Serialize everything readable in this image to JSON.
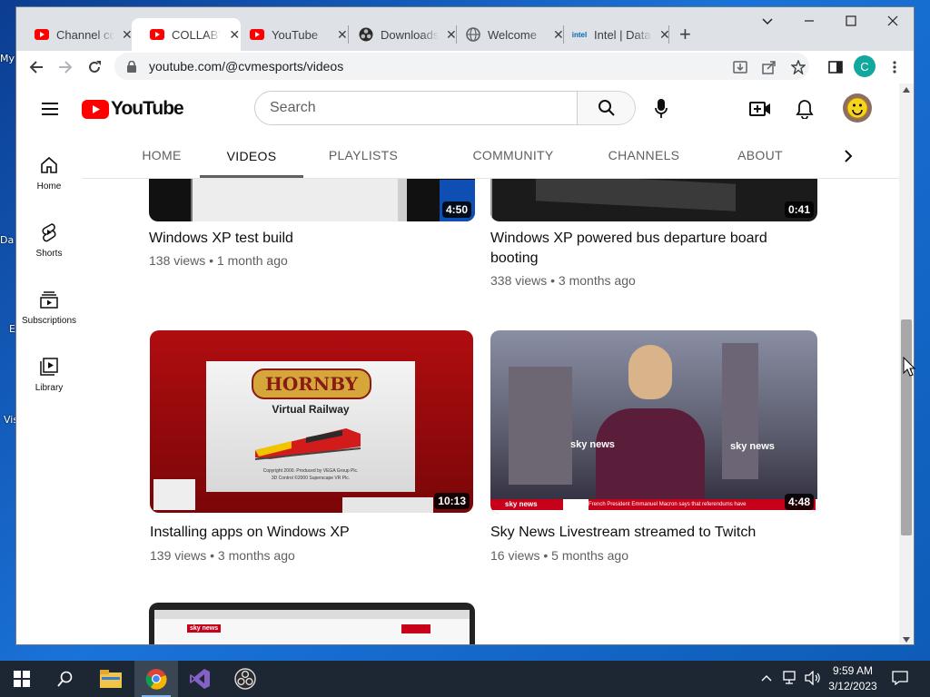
{
  "desktop": {
    "icon_labels": [
      "My",
      "Da",
      "E",
      "Vis"
    ]
  },
  "browser": {
    "tabs": [
      {
        "title": "Channel content",
        "favicon": "youtube-icon",
        "active": false
      },
      {
        "title": "COLLABVM",
        "favicon": "youtube-icon",
        "active": true
      },
      {
        "title": "YouTube",
        "favicon": "youtube-icon",
        "active": false
      },
      {
        "title": "Downloads",
        "favicon": "obs-icon",
        "active": false
      },
      {
        "title": "Welcome",
        "favicon": "globe-icon",
        "active": false
      },
      {
        "title": "Intel | Data",
        "favicon": "intel-icon",
        "active": false
      }
    ],
    "url": "youtube.com/@cvmesports/videos"
  },
  "youtube": {
    "logo_text": "YouTube",
    "search_placeholder": "Search",
    "guide": [
      {
        "label": "Home",
        "icon": "home-icon"
      },
      {
        "label": "Shorts",
        "icon": "shorts-icon"
      },
      {
        "label": "Subscriptions",
        "icon": "subscriptions-icon"
      },
      {
        "label": "Library",
        "icon": "library-icon"
      }
    ],
    "channel_tabs": [
      "HOME",
      "VIDEOS",
      "PLAYLISTS",
      "COMMUNITY",
      "CHANNELS",
      "ABOUT"
    ],
    "selected_tab": "VIDEOS",
    "videos": [
      {
        "title": "Windows XP test build",
        "meta": "138 views • 1 month ago",
        "duration": "4:50"
      },
      {
        "title": "Windows XP powered bus departure board booting",
        "meta": "338 views • 3 months ago",
        "duration": "0:41"
      },
      {
        "title": "Installing apps on Windows XP",
        "meta": "139 views • 3 months ago",
        "duration": "10:13"
      },
      {
        "title": "Sky News Livestream streamed to Twitch",
        "meta": "16 views • 5 months ago",
        "duration": "4:48"
      }
    ],
    "thumb_text": {
      "hornby_brand": "HORNBY",
      "hornby_sub": "Virtual Railway",
      "hornby_copy1": "Copyright 2000. Produced by VEGA Group Plc.",
      "hornby_copy2": "3D Control ©2000 Superscape VR Plc.",
      "sky_logo": "sky news",
      "sky_ticker": "French President Emmanuel Macron says that referendums have"
    }
  },
  "taskbar": {
    "time": "9:59 AM",
    "date": "3/12/2023"
  },
  "colors": {
    "youtube_red": "#ff0000",
    "tab_strip": "#dee1e6",
    "taskbar": "#1c2733"
  }
}
